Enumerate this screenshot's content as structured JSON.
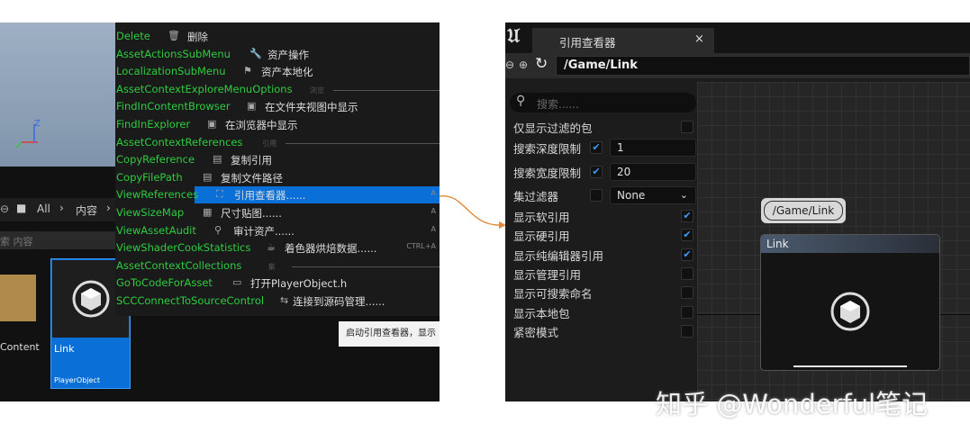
{
  "left": {
    "axis": {
      "z": "Z"
    },
    "breadcrumb": {
      "all": "All",
      "content": "内容",
      "sep": "›"
    },
    "search_placeholder": "索 内容",
    "thumbs": [
      {
        "label": "Content"
      },
      {
        "label": "Link",
        "sublabel": "PlayerObject"
      }
    ],
    "menu": [
      {
        "type": "item",
        "en": "Delete",
        "icon": "🗑",
        "cn": "删除",
        "shortcut": ""
      },
      {
        "type": "item",
        "en": "AssetActionsSubMenu",
        "icon": "🔧",
        "cn": "资产操作",
        "shortcut": ""
      },
      {
        "type": "item",
        "en": "LocalizationSubMenu",
        "icon": "⚑",
        "cn": "资产本地化",
        "shortcut": ""
      },
      {
        "type": "section",
        "en": "AssetContextExploreMenuOptions",
        "cn": "浏览"
      },
      {
        "type": "item",
        "en": "FindInContentBrowser",
        "icon": "▣",
        "cn": "在文件夹视图中显示",
        "shortcut": ""
      },
      {
        "type": "item",
        "en": "FindInExplorer",
        "icon": "▣",
        "cn": "在浏览器中显示",
        "shortcut": ""
      },
      {
        "type": "section",
        "en": "AssetContextReferences",
        "cn": "引用"
      },
      {
        "type": "item",
        "en": "CopyReference",
        "icon": "▤",
        "cn": "复制引用",
        "shortcut": ""
      },
      {
        "type": "item",
        "en": "CopyFilePath",
        "icon": "▤",
        "cn": "复制文件路径",
        "shortcut": ""
      },
      {
        "type": "item",
        "en": "ViewReferences",
        "icon": "⛶",
        "cn": "引用查看器......",
        "shortcut": "A",
        "highlight": true
      },
      {
        "type": "item",
        "en": "ViewSizeMap",
        "icon": "▦",
        "cn": "尺寸贴图......",
        "shortcut": "A"
      },
      {
        "type": "item",
        "en": "ViewAssetAudit",
        "icon": "⚲",
        "cn": "审计资产......",
        "shortcut": "A"
      },
      {
        "type": "item",
        "en": "ViewShaderCookStatistics",
        "icon": "☕",
        "cn": "着色器烘焙数据......",
        "shortcut": "CTRL+A"
      },
      {
        "type": "section",
        "en": "AssetContextCollections",
        "cn": "集"
      },
      {
        "type": "item",
        "en": "GoToCodeForAsset",
        "icon": "▭",
        "cn": "打开PlayerObject.h",
        "shortcut": ""
      },
      {
        "type": "item",
        "en": "SCCConnectToSourceControl",
        "icon": "⇆",
        "cn": "连接到源码管理......",
        "shortcut": ""
      }
    ],
    "tooltip": "启动引用查看器，显示"
  },
  "right": {
    "tab_title": "引用查看器",
    "tab_close": "×",
    "path": "/Game/Link",
    "search_placeholder": "搜索......",
    "options": [
      {
        "label": "仅显示过滤的包",
        "checked": false
      },
      {
        "label": "搜索深度限制",
        "checked": true,
        "value": "1"
      },
      {
        "label": "搜索宽度限制",
        "checked": true,
        "value": "20"
      },
      {
        "label": "集过滤器",
        "checked": false,
        "value": "None"
      },
      {
        "label": "显示软引用",
        "checked": true
      },
      {
        "label": "显示硬引用",
        "checked": true
      },
      {
        "label": "显示纯编辑器引用",
        "checked": true
      },
      {
        "label": "显示管理引用",
        "checked": false
      },
      {
        "label": "显示可搜索命名",
        "checked": false
      },
      {
        "label": "显示本地包",
        "checked": false
      },
      {
        "label": "紧密模式",
        "checked": false
      }
    ],
    "node": {
      "bubble": "/Game/Link",
      "title": "Link"
    }
  },
  "watermark": "知乎 @Wonderful笔记",
  "colors": {
    "accent": "#0a6fd6",
    "menu_green": "#2ecc40",
    "arrow": "#e08a3a",
    "checkbox": "#3b9cff"
  }
}
